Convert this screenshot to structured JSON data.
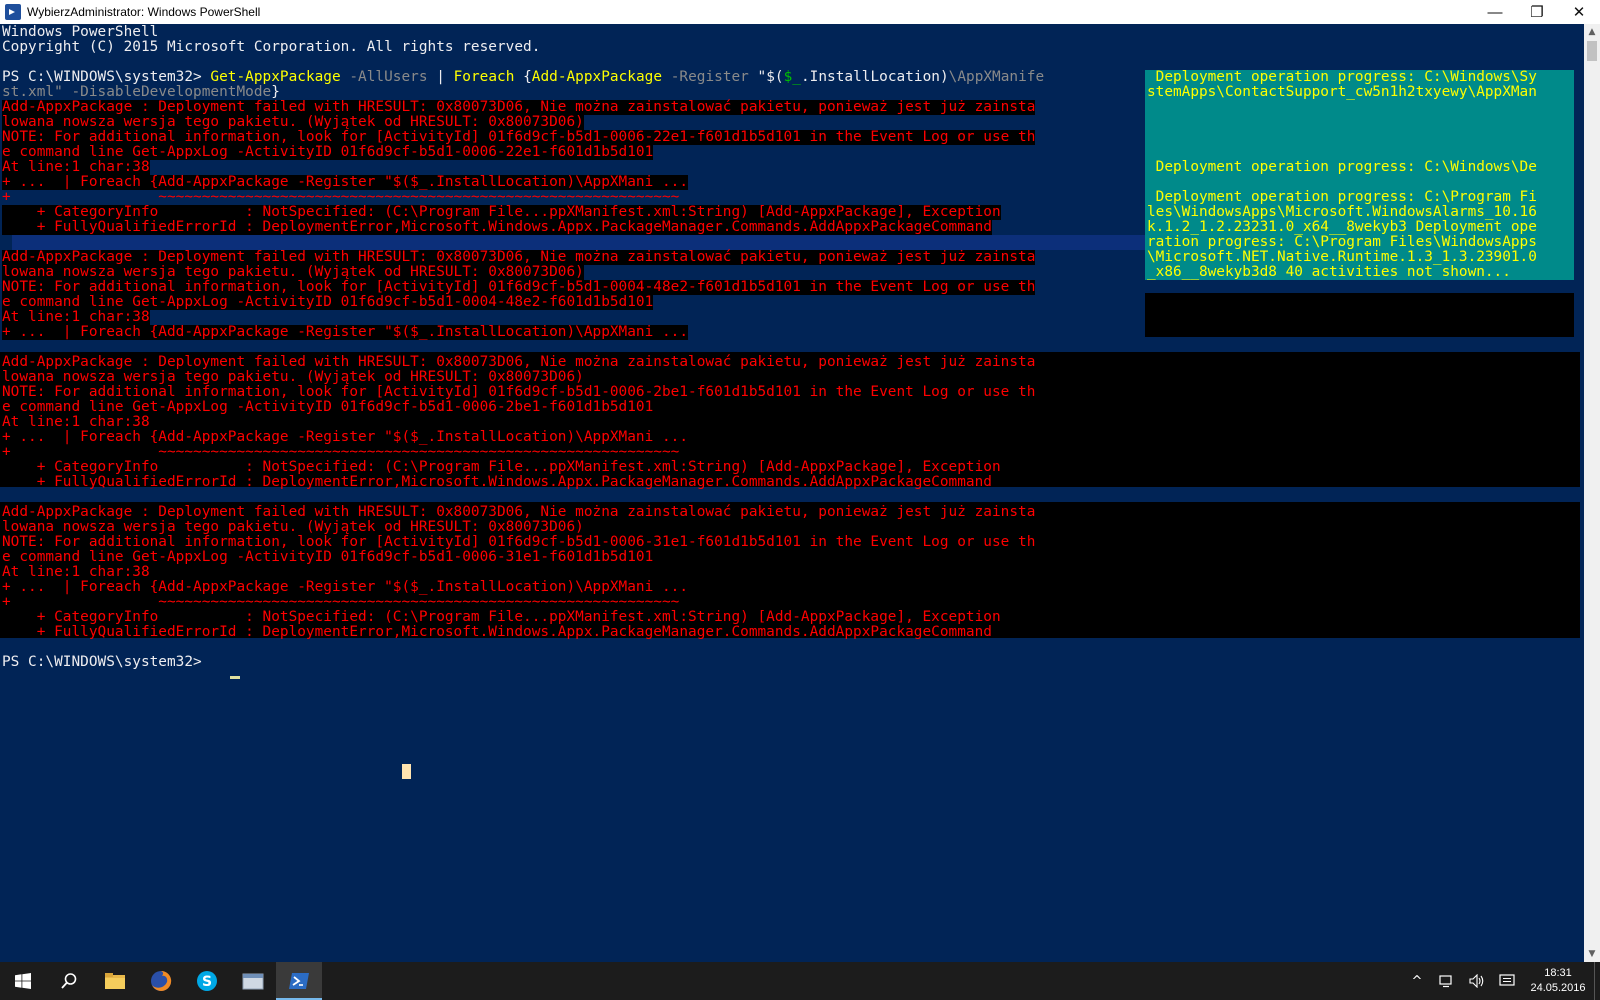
{
  "window": {
    "title": "WybierzAdministrator: Windows PowerShell",
    "minimize": "—",
    "restore": "❐",
    "close": "✕"
  },
  "console": {
    "header1": "Windows PowerShell",
    "header2": "Copyright (C) 2015 Microsoft Corporation. All rights reserved.",
    "prompt": "PS C:\\WINDOWS\\system32> ",
    "cmd_get": "Get-AppxPackage",
    "cmd_allusers": " -AllUsers",
    "cmd_pipe": " | ",
    "cmd_foreach": "Foreach",
    "cmd_brace": " {",
    "cmd_add": "Add-AppxPackage",
    "cmd_register": " -Register",
    "cmd_str1": " \"$(",
    "cmd_var": "$_",
    "cmd_str2": ".InstallLocation)",
    "cmd_str3": "\\AppXManife",
    "cmd_line2a": "st.xml\"",
    "cmd_line2b": " -DisableDevelopmentMode",
    "cmd_line2c": "}",
    "err_blocks": [
      {
        "l1": "Add-AppxPackage : Deployment failed with HRESULT: 0x80073D06, Nie można zainstalować pakietu, ponieważ jest już zainsta",
        "l2": "lowana nowsza wersja tego pakietu. (Wyjątek od HRESULT: 0x80073D06)",
        "l3": "NOTE: For additional information, look for [ActivityId] 01f6d9cf-b5d1-0006-22e1-f601d1b5d101 in the Event Log or use th",
        "l4": "e command line Get-AppxLog -ActivityID 01f6d9cf-b5d1-0006-22e1-f601d1b5d101",
        "l5": "At line:1 char:38",
        "l6": "+ ...  | Foreach {Add-AppxPackage -Register \"$($_.InstallLocation)\\AppXMani ...",
        "l7": "+                 ~~~~~~~~~~~~~~~~~~~~~~~~~~~~~~~~~~~~~~~~~~~~~~~~~~~~~~~~~~~~",
        "l8": "    + CategoryInfo          : NotSpecified: (C:\\Program File...ppXManifest.xml:String) [Add-AppxPackage], Exception",
        "l9": "    + FullyQualifiedErrorId : DeploymentError,Microsoft.Windows.Appx.PackageManager.Commands.AddAppxPackageCommand"
      },
      {
        "l1": "Add-AppxPackage : Deployment failed with HRESULT: 0x80073D06, Nie można zainstalować pakietu, ponieważ jest już zainsta",
        "l2": "lowana nowsza wersja tego pakietu. (Wyjątek od HRESULT: 0x80073D06)",
        "l3": "NOTE: For additional information, look for [ActivityId] 01f6d9cf-b5d1-0004-48e2-f601d1b5d101 in the Event Log or use th",
        "l4": "e command line Get-AppxLog -ActivityID 01f6d9cf-b5d1-0004-48e2-f601d1b5d101",
        "l5": "At line:1 char:38",
        "l6": "+ ...  | Foreach {Add-AppxPackage -Register \"$($_.InstallLocation)\\AppXMani ..."
      },
      {
        "l1": "Add-AppxPackage : Deployment failed with HRESULT: 0x80073D06, Nie można zainstalować pakietu, ponieważ jest już zainsta",
        "l2": "lowana nowsza wersja tego pakietu. (Wyjątek od HRESULT: 0x80073D06)",
        "l3": "NOTE: For additional information, look for [ActivityId] 01f6d9cf-b5d1-0006-2be1-f601d1b5d101 in the Event Log or use th",
        "l4": "e command line Get-AppxLog -ActivityID 01f6d9cf-b5d1-0006-2be1-f601d1b5d101",
        "l5": "At line:1 char:38",
        "l6": "+ ...  | Foreach {Add-AppxPackage -Register \"$($_.InstallLocation)\\AppXMani ...",
        "l7": "+                 ~~~~~~~~~~~~~~~~~~~~~~~~~~~~~~~~~~~~~~~~~~~~~~~~~~~~~~~~~~~~",
        "l8": "    + CategoryInfo          : NotSpecified: (C:\\Program File...ppXManifest.xml:String) [Add-AppxPackage], Exception",
        "l9": "    + FullyQualifiedErrorId : DeploymentError,Microsoft.Windows.Appx.PackageManager.Commands.AddAppxPackageCommand"
      },
      {
        "l1": "Add-AppxPackage : Deployment failed with HRESULT: 0x80073D06, Nie można zainstalować pakietu, ponieważ jest już zainsta",
        "l2": "lowana nowsza wersja tego pakietu. (Wyjątek od HRESULT: 0x80073D06)",
        "l3": "NOTE: For additional information, look for [ActivityId] 01f6d9cf-b5d1-0006-31e1-f601d1b5d101 in the Event Log or use th",
        "l4": "e command line Get-AppxLog -ActivityID 01f6d9cf-b5d1-0006-31e1-f601d1b5d101",
        "l5": "At line:1 char:38",
        "l6": "+ ...  | Foreach {Add-AppxPackage -Register \"$($_.InstallLocation)\\AppXMani ...",
        "l7": "+                 ~~~~~~~~~~~~~~~~~~~~~~~~~~~~~~~~~~~~~~~~~~~~~~~~~~~~~~~~~~~~",
        "l8": "    + CategoryInfo          : NotSpecified: (C:\\Program File...ppXManifest.xml:String) [Add-AppxPackage], Exception",
        "l9": "    + FullyQualifiedErrorId : DeploymentError,Microsoft.Windows.Appx.PackageManager.Commands.AddAppxPackageCommand"
      }
    ],
    "final_prompt": "PS C:\\WINDOWS\\system32> "
  },
  "progress": {
    "lines": [
      " Deployment operation progress: C:\\Windows\\Sy",
      "stemApps\\ContactSupport_cw5n1h2txyewy\\AppXMan",
      " Deployment operation progress: C:\\Windows\\De",
      " Deployment operation progress: C:\\Program Fi",
      "les\\WindowsApps\\Microsoft.WindowsAlarms_10.16",
      "k.1.2_1.2.23231.0_x64__8wekyb3 Deployment ope",
      "ration progress: C:\\Program Files\\WindowsApps",
      "\\Microsoft.NET.Native.Runtime.1.3_1.3.23901.0",
      "_x86__8wekyb3d8 40 activities not shown..."
    ]
  },
  "scrollbar": {
    "up": "▲",
    "down": "▼"
  },
  "taskbar": {
    "items": [
      "start-button",
      "search-button",
      "file-explorer",
      "firefox",
      "skype",
      "app-window",
      "powershell"
    ],
    "tray_chevron": "^",
    "clock_time": "18:31",
    "clock_date": "24.05.2016"
  },
  "colors": {
    "console_bg": "#012456",
    "error_fg": "#ff0000",
    "error_bg": "#000000",
    "progress_bg": "#008a8a",
    "progress_fg": "#ffff00",
    "command_fg": "#ffff00"
  }
}
